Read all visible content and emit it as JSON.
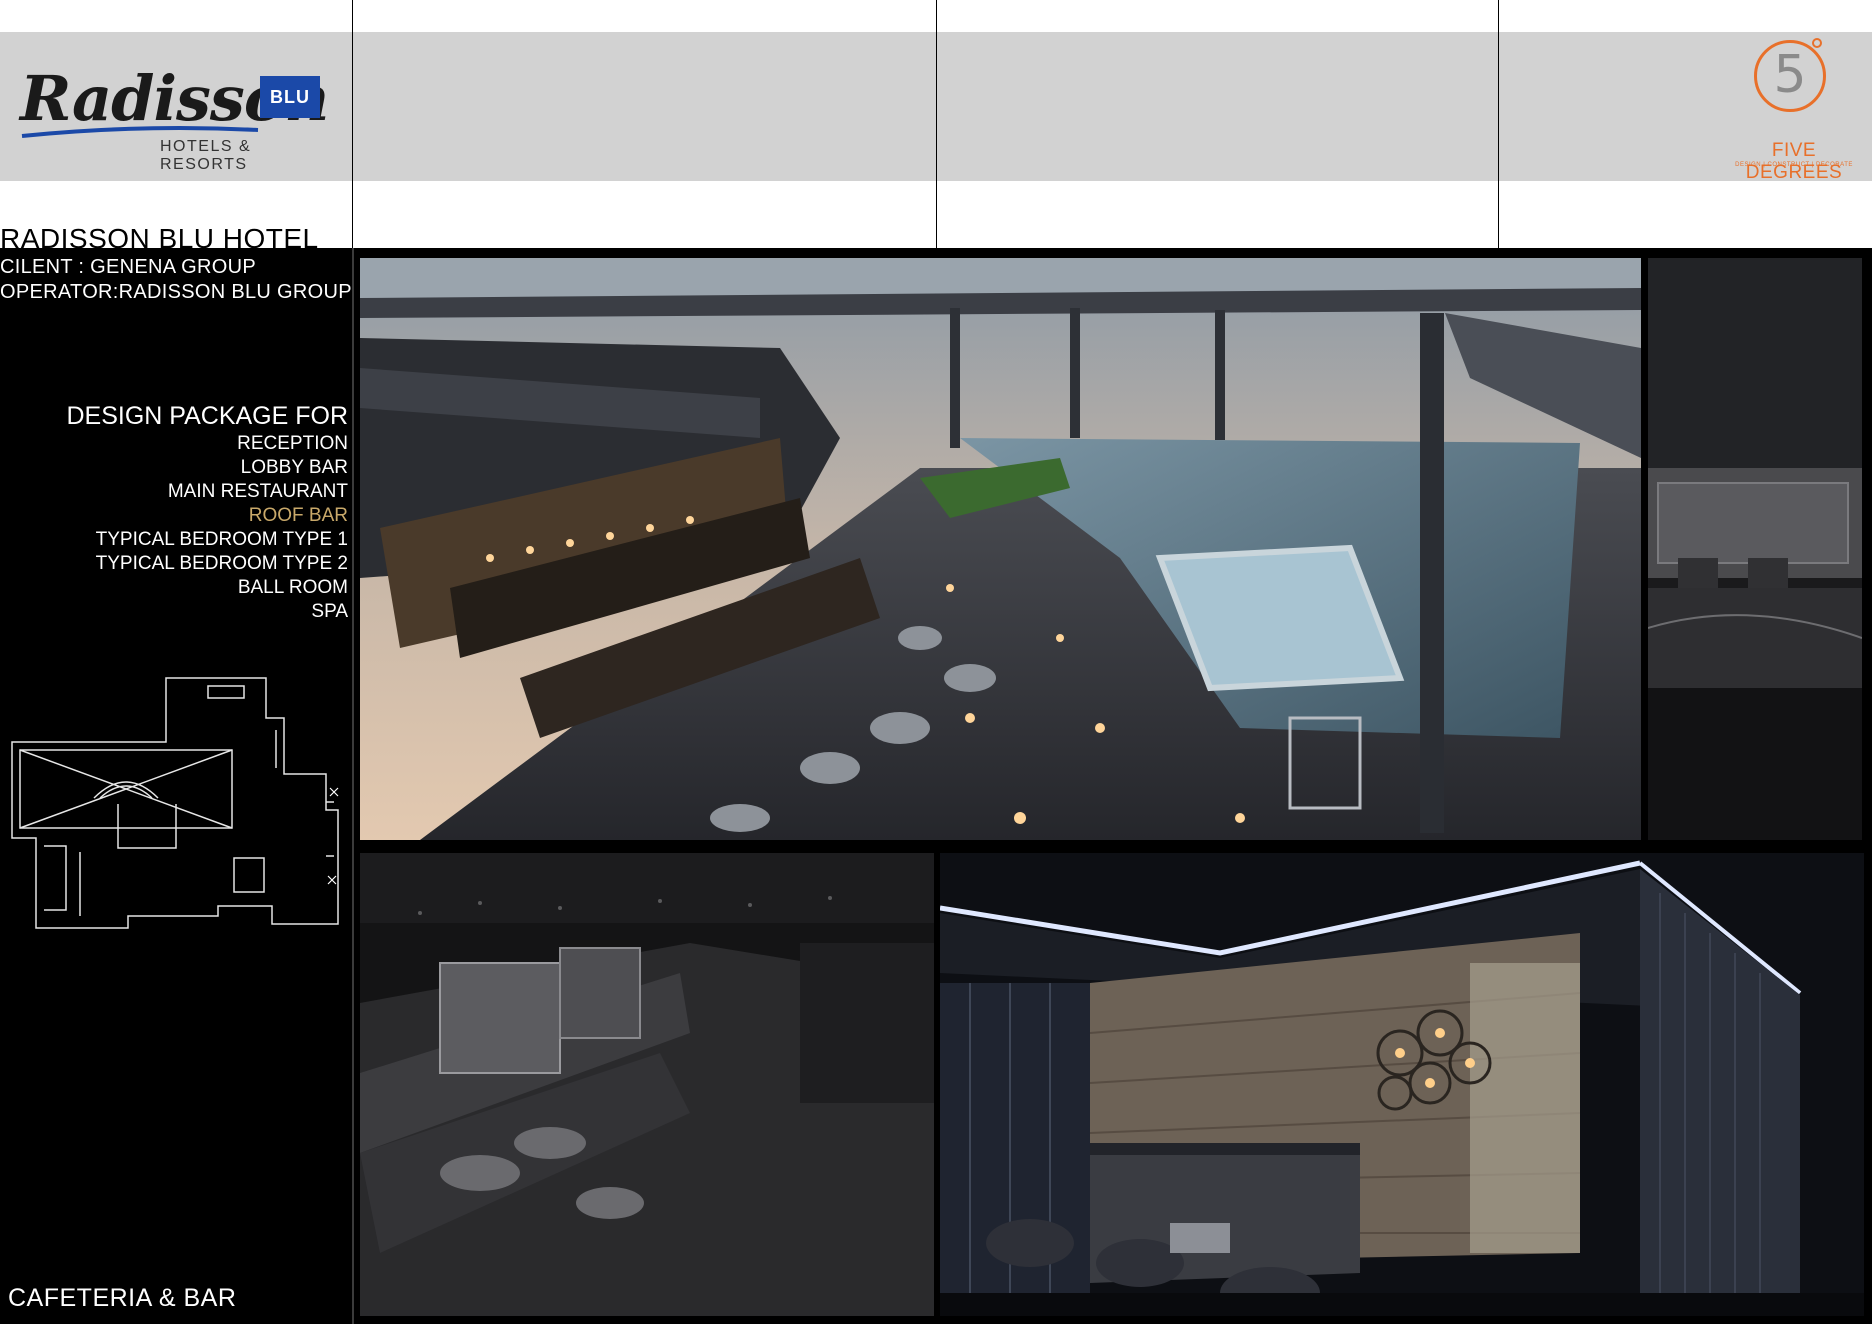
{
  "header": {
    "brand_script": "Radisson",
    "brand_badge": "BLU",
    "brand_tagline": "HOTELS & RESORTS",
    "partner_number": "5",
    "partner_name": "FIVE DEGREES",
    "partner_sub": "DESIGN | CONSTRUCT | DECORATE"
  },
  "project": {
    "title": "RADISSON BLU HOTEL",
    "client": "CILENT : GENENA GROUP",
    "operator": "OPERATOR:RADISSON BLU GROUP"
  },
  "package": {
    "heading": "DESIGN PACKAGE FOR",
    "items": [
      {
        "label": "RECEPTION",
        "active": false
      },
      {
        "label": "LOBBY BAR",
        "active": false
      },
      {
        "label": "MAIN RESTAURANT",
        "active": false
      },
      {
        "label": "ROOF BAR",
        "active": true
      },
      {
        "label": "TYPICAL BEDROOM TYPE 1",
        "active": false
      },
      {
        "label": "TYPICAL BEDROOM TYPE 2",
        "active": false
      },
      {
        "label": "BALL ROOM",
        "active": false
      },
      {
        "label": "SPA",
        "active": false
      }
    ]
  },
  "footer": {
    "section_label": "CAFETERIA & BAR"
  },
  "colors": {
    "accent_orange": "#e8702a",
    "brand_blue": "#1b49a8",
    "active_item": "#c9a96a",
    "band_grey": "#d2d2d2"
  }
}
